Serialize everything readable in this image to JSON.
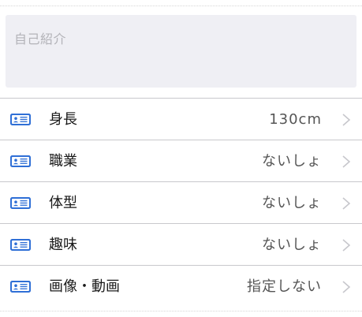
{
  "bio": {
    "placeholder": "自己紹介"
  },
  "profile_rows": [
    {
      "label": "身長",
      "value": "130cm",
      "icon": "id-card-icon"
    },
    {
      "label": "職業",
      "value": "ないしょ",
      "icon": "id-card-icon"
    },
    {
      "label": "体型",
      "value": "ないしょ",
      "icon": "id-card-icon"
    },
    {
      "label": "趣味",
      "value": "ないしょ",
      "icon": "id-card-icon"
    },
    {
      "label": "画像・動画",
      "value": "指定しない",
      "icon": "id-card-icon"
    }
  ],
  "colors": {
    "accent": "#2f6fd6",
    "chevron": "#c7c7cc",
    "separator": "#c8c8cc",
    "bio_background": "#efeff4"
  }
}
